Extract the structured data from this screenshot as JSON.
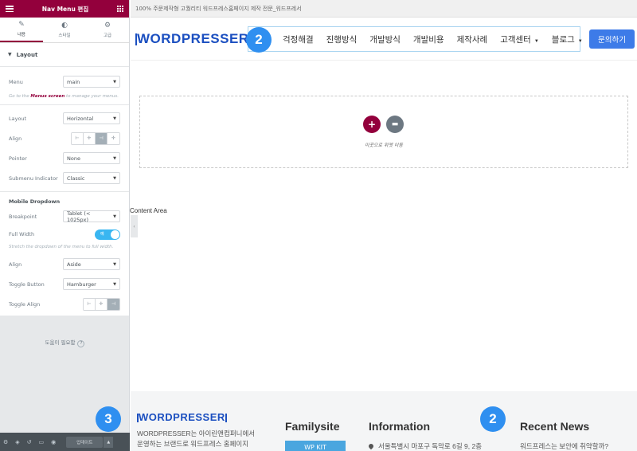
{
  "panel": {
    "header_title": "Nav Menu 편집",
    "tabs": [
      {
        "label": "내용",
        "icon": "pencil-icon"
      },
      {
        "label": "스타일",
        "icon": "half-circle-icon"
      },
      {
        "label": "고급",
        "icon": "gear-icon"
      }
    ],
    "section_title": "Layout",
    "menu_label": "Menu",
    "menu_value": "main",
    "menu_note_pre": "Go to the ",
    "menu_note_link": "Menus screen",
    "menu_note_post": " to manage your menus.",
    "layout_label": "Layout",
    "layout_value": "Horizontal",
    "align_label": "Align",
    "pointer_label": "Pointer",
    "pointer_value": "None",
    "submenu_label": "Submenu Indicator",
    "submenu_value": "Classic",
    "mobile_heading": "Mobile Dropdown",
    "breakpoint_label": "Breakpoint",
    "breakpoint_value": "Tablet (< 1025px)",
    "fullwidth_label": "Full Width",
    "fullwidth_toggle": "예",
    "fullwidth_note": "Stretch the dropdown of the menu to full width.",
    "align2_label": "Align",
    "align2_value": "Aside",
    "toggle_btn_label": "Toggle Button",
    "toggle_btn_value": "Hamburger",
    "toggle_align_label": "Toggle Align",
    "help_text": "도움이 필요함",
    "update_label": "업데이트"
  },
  "browser": {
    "title": "100% 주문제작형 고퀄리티 워드프레스홈페이지 제작 전문_워드프레서"
  },
  "header": {
    "logo": "WORDPRESSER",
    "nav": [
      "걱정해결",
      "진행방식",
      "개발방식",
      "개발비용",
      "제작사례",
      "고객센터",
      "블로그"
    ],
    "cta": "문의하기"
  },
  "badges": [
    "2",
    "3",
    "2"
  ],
  "canvas": {
    "drop_text": "이곳으로 위젯 이동",
    "content_area": "Content Area"
  },
  "footer": {
    "logo": "WORDPRESSER",
    "about_line1": "WORDPRESSER는 아이린앤컴퍼니에서",
    "about_line2": "운영하는 브랜드로 워드프레스 홈페이지",
    "familysite": "Familysite",
    "wpkit": "WP KIT",
    "information": "Information",
    "address": "서울특별시 마포구 독막로 6길 9, 2층",
    "recent_news": "Recent News",
    "news1": "워드프레스는 보안에 취약할까?"
  },
  "colors": {
    "panel_accent": "#93003c",
    "logo_blue": "#1b4fc0",
    "cta_blue": "#3d7be8",
    "badge_blue": "#2f8ff0",
    "toggle_blue": "#39b6f1"
  }
}
